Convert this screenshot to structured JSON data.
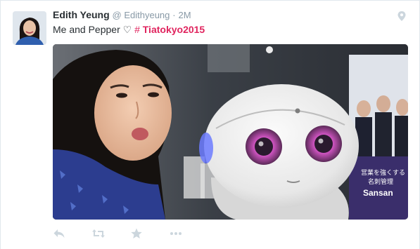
{
  "tweet": {
    "author": {
      "name": "Edith Yeung",
      "handle": "@ Edithyeung",
      "separator": "·",
      "time": "2M"
    },
    "text": {
      "body": "Me and Pepper ♡",
      "hash": "#",
      "hashtag": "Tiatokyo2015"
    },
    "icons": {
      "location": "location-pin-icon",
      "reply": "reply-icon",
      "retweet": "retweet-icon",
      "favorite": "star-icon",
      "more": "more-icon"
    },
    "media": {
      "poster_jp_line1": "営業を強くする",
      "poster_jp_line2": "名刺管理",
      "poster_brand": "Sansan"
    }
  },
  "colors": {
    "hashtag": "#e0245e",
    "secondary_text": "#8899a6",
    "icon_gray": "#ccd6dd"
  }
}
